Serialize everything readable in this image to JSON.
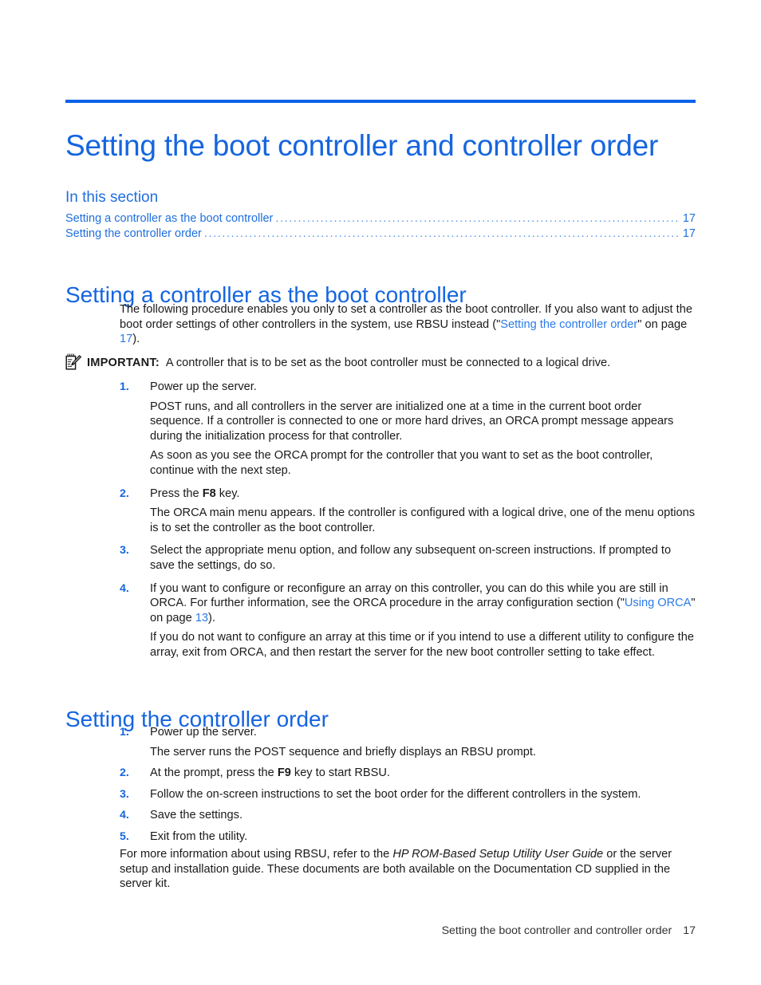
{
  "document": {
    "title": "Setting the boot controller and controller order",
    "accent_color": "#1565e0",
    "rule_color": "#0b61e8",
    "link_color": "#2b7ae8",
    "body_color": "#1a1a1a"
  },
  "toc": {
    "heading": "In this section",
    "entries": [
      {
        "label": "Setting a controller as the boot controller",
        "dots": "...................................................................................................",
        "page": "17"
      },
      {
        "label": "Setting the controller order",
        "dots": "......................................................................................................................",
        "page": "17"
      }
    ]
  },
  "section1": {
    "heading": "Setting a controller as the boot controller",
    "intro": {
      "text_before": "The following procedure enables you only to set a controller as the boot controller. If you also want to adjust the boot order settings of other controllers in the system, use RBSU instead (\"",
      "link": "Setting the controller order",
      "text_middle": "\" on page ",
      "page_ref": "17",
      "text_after": ")."
    },
    "important": {
      "icon": "notepad-pencil-icon",
      "label": "IMPORTANT:",
      "text": "A controller that is to be set as the boot controller must be connected to a logical drive."
    },
    "steps": [
      {
        "num": "1.",
        "text": "Power up the server.",
        "subs": [
          "POST runs, and all controllers in the server are initialized one at a time in the current boot order sequence. If a controller is connected to one or more hard drives, an ORCA prompt message appears during the initialization process for that controller.",
          "As soon as you see the ORCA prompt for the controller that you want to set as the boot controller, continue with the next step."
        ]
      },
      {
        "num": "2.",
        "text_before": "Press the ",
        "key": "F8",
        "text_after": " key.",
        "subs": [
          "The ORCA main menu appears. If the controller is configured with a logical drive, one of the menu options is to set the controller as the boot controller."
        ]
      },
      {
        "num": "3.",
        "text": "Select the appropriate menu option, and follow any subsequent on-screen instructions. If prompted to save the settings, do so.",
        "subs": []
      },
      {
        "num": "4.",
        "text_before": "If you want to configure or reconfigure an array on this controller, you can do this while you are still in ORCA. For further information, see the ORCA procedure in the array configuration section (\"",
        "link": "Using ORCA",
        "text_middle": "\" on page ",
        "page_ref": "13",
        "text_after": ").",
        "subs": [
          "If you do not want to configure an array at this time or if you intend to use a different utility to configure the array, exit from ORCA, and then restart the server for the new boot controller setting to take effect."
        ]
      }
    ]
  },
  "section2": {
    "heading": "Setting the controller order",
    "steps": [
      {
        "num": "1.",
        "text": "Power up the server.",
        "subs": [
          "The server runs the POST sequence and briefly displays an RBSU prompt."
        ]
      },
      {
        "num": "2.",
        "text_before": "At the prompt, press the ",
        "key": "F9",
        "text_after": " key to start RBSU.",
        "subs": []
      },
      {
        "num": "3.",
        "text": "Follow the on-screen instructions to set the boot order for the different controllers in the system.",
        "subs": []
      },
      {
        "num": "4.",
        "text": "Save the settings.",
        "subs": []
      },
      {
        "num": "5.",
        "text": "Exit from the utility.",
        "subs": []
      }
    ],
    "closing": {
      "text_before": "For more information about using RBSU, refer to the ",
      "italic": "HP ROM-Based Setup Utility User Guide",
      "text_after": " or the server setup and installation guide. These documents are both available on the Documentation CD supplied in the server kit."
    }
  },
  "footer": {
    "text": "Setting the boot controller and controller order",
    "page": "17"
  }
}
